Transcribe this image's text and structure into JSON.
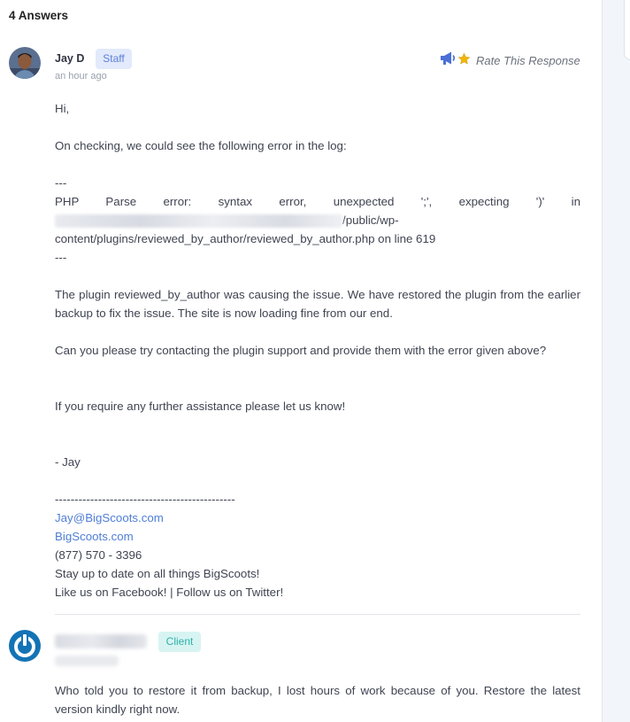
{
  "answers": {
    "heading": "4 Answers"
  },
  "staff_answer": {
    "author": "Jay D",
    "badge": "Staff",
    "time": "an hour ago",
    "rate_label": "Rate This Response",
    "greeting": "Hi,",
    "p1": "On checking, we could see the following error in the log:",
    "sep_open": "---",
    "error_line": "PHP Parse error: syntax error, unexpected ';', expecting ')' in",
    "error_path_tail": "/public/wp-",
    "error_path_rest": "content/plugins/reviewed_by_author/reviewed_by_author.php on line 619",
    "sep_close": "---",
    "p2": "The plugin reviewed_by_author was causing the issue. We have restored the plugin from the earlier backup to fix the issue. The site is now loading fine from our end.",
    "p3": "Can you please try contacting the plugin support and provide them with the error given above?",
    "p4": "If you require any further assistance please let us know!",
    "signoff": "- Jay",
    "sig_line": "----------------------------------------------",
    "email": "Jay@BigScoots.com",
    "website": "BigScoots.com",
    "phone": "(877) 570 - 3396",
    "tagline": "Stay up to date on all things BigScoots!",
    "social": "Like us on Facebook! | Follow us on Twitter!"
  },
  "client_answer": {
    "badge": "Client",
    "message": "Who told you to restore it from backup, I lost hours of work because of you. Restore the latest version kindly right now."
  },
  "colors": {
    "staff_badge": "#e2eafb",
    "client_badge": "#d7f4f2",
    "link": "#4f7ed6",
    "megaphone": "#4a6fd6",
    "star": "#f2b705"
  },
  "icons": {
    "rate": [
      "megaphone-icon",
      "star-icon"
    ],
    "client_avatar": "power-icon"
  }
}
